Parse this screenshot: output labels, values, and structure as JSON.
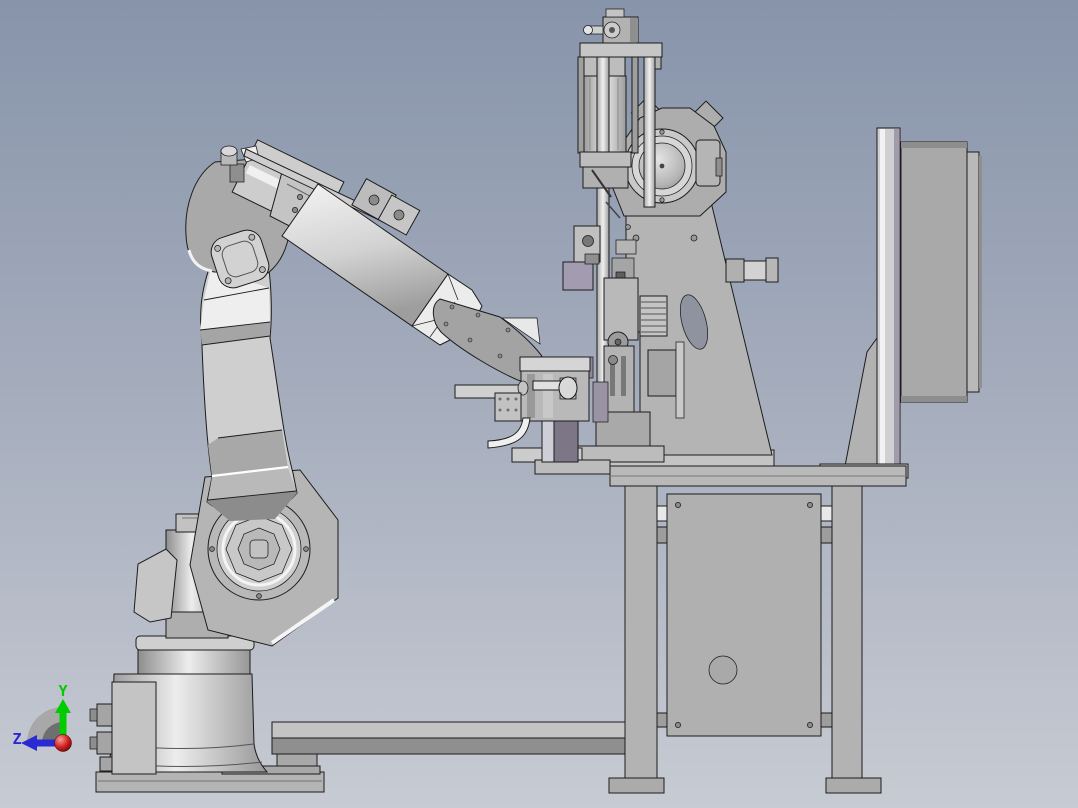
{
  "viewport": {
    "background": {
      "top": "#8794aa",
      "middle": "#a9b0bf",
      "bottom": "#c7cbd3"
    }
  },
  "triad": {
    "vertical_axis": {
      "label": "Y",
      "color": "#00cc00"
    },
    "horizontal_axis": {
      "label": "Z",
      "color": "#2a2ad2"
    },
    "origin_color": "#d32222"
  }
}
